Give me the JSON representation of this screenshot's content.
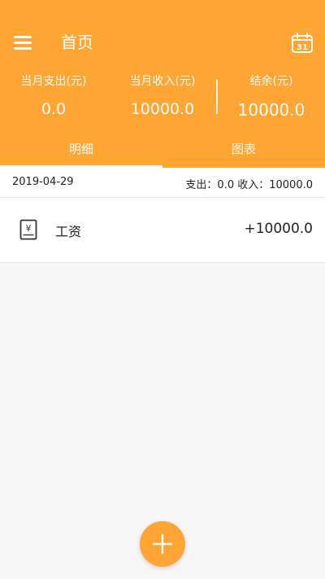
{
  "topbar": {
    "title": "首页",
    "menu_icon": "menu-icon",
    "calendar_icon": "calendar-icon",
    "calendar_day": "31"
  },
  "stats": {
    "expense": {
      "label": "当月支出(元)",
      "value": "0.0"
    },
    "income": {
      "label": "当月收入(元)",
      "value": "10000.0"
    },
    "balance": {
      "label": "结余(元)",
      "value": "10000.0"
    }
  },
  "tabs": [
    {
      "label": "明细",
      "selected": true
    },
    {
      "label": "图表",
      "selected": false
    }
  ],
  "records": {
    "date": "2019-04-29",
    "summary": "支出：0.0 收入：10000.0",
    "items": [
      {
        "icon": "salary-icon",
        "icon_symbol": "¥",
        "name": "工资",
        "amount": "+10000.0"
      }
    ]
  },
  "fab": {
    "icon": "plus-icon"
  },
  "colors": {
    "accent": "#ffa533",
    "background": "#f7f7f7",
    "text": "#222222"
  }
}
